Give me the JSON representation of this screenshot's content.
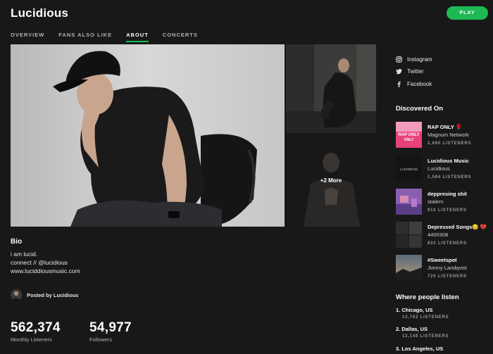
{
  "header": {
    "artist": "Lucidious",
    "play_label": "PLAY",
    "tabs": [
      {
        "label": "OVERVIEW"
      },
      {
        "label": "FANS ALSO LIKE"
      },
      {
        "label": "ABOUT"
      },
      {
        "label": "CONCERTS"
      }
    ],
    "active_tab": "ABOUT"
  },
  "gallery": {
    "more_label": "+2 More"
  },
  "bio": {
    "title": "Bio",
    "lines": [
      "i am lucid.",
      "connect // @lucidious",
      "www.luciddiousmusic.com"
    ],
    "posted_by": "Posted by Lucidious"
  },
  "stats": {
    "monthly": {
      "value": "562,374",
      "label": "Monthly Listeners"
    },
    "followers": {
      "value": "54,977",
      "label": "Followers"
    }
  },
  "social": [
    {
      "icon": "instagram-icon",
      "label": "Instagram"
    },
    {
      "icon": "twitter-icon",
      "label": "Twitter"
    },
    {
      "icon": "facebook-icon",
      "label": "Facebook"
    }
  ],
  "discovered": {
    "title": "Discovered On",
    "items": [
      {
        "title": "RAP ONLY 🌹",
        "owner": "Magnum Network",
        "listeners": "2,660 LISTENERS",
        "cover_text": "RAP ONLY"
      },
      {
        "title": "Lucidious Music",
        "owner": "Lucidious",
        "listeners": "1,584 LISTENERS",
        "cover_text": "LUCIDIOUS"
      },
      {
        "title": "deppresing shit",
        "owner": "stalern",
        "listeners": "910 LISTENERS",
        "cover_text": ""
      },
      {
        "title": "Depressed Songs😔 💔",
        "owner": "4400308",
        "listeners": "832 LISTENERS",
        "cover_text": ""
      },
      {
        "title": "#Sweetspot",
        "owner": "Jimmy Landqvist",
        "listeners": "720 LISTENERS",
        "cover_text": ""
      }
    ]
  },
  "where": {
    "title": "Where people listen",
    "items": [
      {
        "city": "1. Chicago, US",
        "listeners": "13,762 LISTENERS"
      },
      {
        "city": "2. Dallas, US",
        "listeners": "12,148 LISTENERS"
      },
      {
        "city": "3. Los Angeles, US",
        "listeners": ""
      }
    ]
  },
  "colors": {
    "background": "#181818",
    "accent": "#1db954"
  }
}
